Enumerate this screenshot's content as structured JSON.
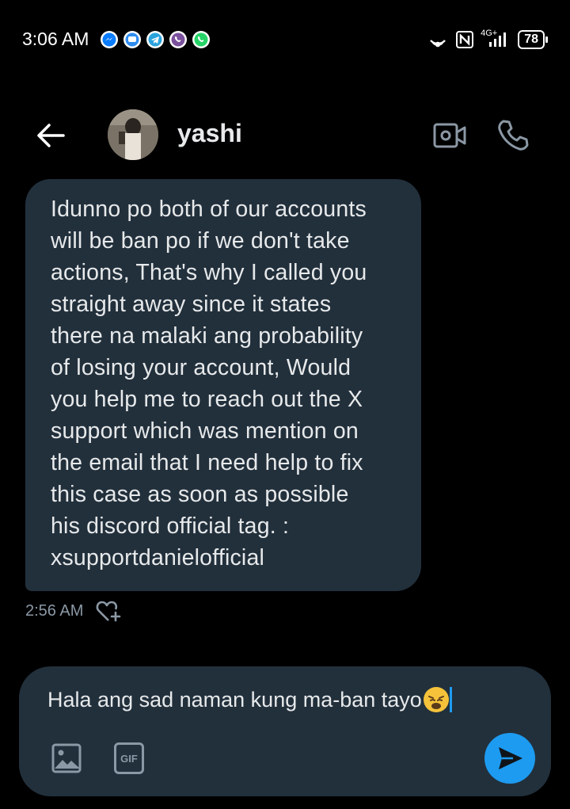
{
  "status_bar": {
    "time": "3:06 AM",
    "battery": "78",
    "network": "4G+",
    "notification_icons": [
      "messenger-icon",
      "chat-bubble-icon",
      "telegram-icon",
      "viber-icon",
      "whatsapp-icon"
    ]
  },
  "header": {
    "contact_name": "yashi"
  },
  "message": {
    "text": "Idunno po both of our accounts\nwill be ban po if we don't take\nactions, That's why I called you\nstraight away since it states\nthere na malaki ang  probability\nof losing your account, Would\nyou help me to reach out the X\nsupport which was mention on\nthe email that I need help to fix\nthis case as soon as possible\nhis discord official tag. :\nxsupportdanielofficial",
    "time": "2:56 AM"
  },
  "composer": {
    "draft": "Hala ang sad naman kung ma-ban tayo",
    "gif_label": "GIF"
  },
  "colors": {
    "background": "#000000",
    "bubble": "#22303c",
    "accent": "#1d9bf0",
    "muted": "#8b98a5"
  }
}
